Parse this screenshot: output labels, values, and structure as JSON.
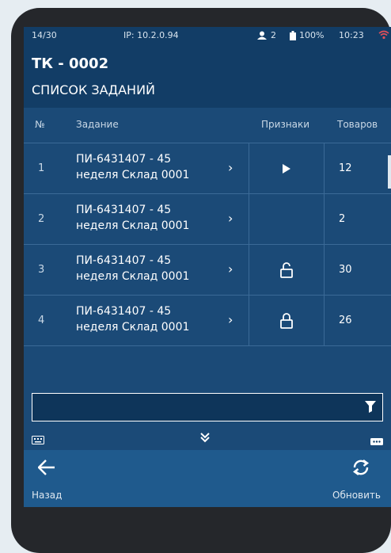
{
  "status": {
    "page": "14/30",
    "ip": "IP: 10.2.0.94",
    "users_count": "2",
    "battery": "100%",
    "time": "10:23"
  },
  "header": {
    "terminal_id": "ТК - 0002",
    "screen_title": "СПИСОК ЗАДАНИЙ"
  },
  "table": {
    "columns": {
      "num": "№",
      "task": "Задание",
      "signs": "Признаки",
      "goods": "Товаров"
    },
    "rows": [
      {
        "num": "1",
        "task_line1": "ПИ-6431407 - 45",
        "task_line2": "неделя Склад 0001",
        "sign_icon": "play-icon",
        "goods": "12"
      },
      {
        "num": "2",
        "task_line1": "ПИ-6431407 - 45",
        "task_line2": "неделя Склад 0001",
        "sign_icon": "",
        "goods": "2"
      },
      {
        "num": "3",
        "task_line1": "ПИ-6431407 - 45",
        "task_line2": "неделя Склад 0001",
        "sign_icon": "unlocked-icon",
        "goods": "30"
      },
      {
        "num": "4",
        "task_line1": "ПИ-6431407 - 45",
        "task_line2": "неделя Склад 0001",
        "sign_icon": "locked-icon",
        "goods": "26"
      }
    ]
  },
  "filter": {
    "value": ""
  },
  "bottom": {
    "back_label": "Назад",
    "refresh_label": "Обновить"
  },
  "colors": {
    "screen_bg": "#123d66",
    "table_bg": "#1b4a77",
    "bottom_bar": "#1f5a8d",
    "device_frame": "#25272b"
  }
}
